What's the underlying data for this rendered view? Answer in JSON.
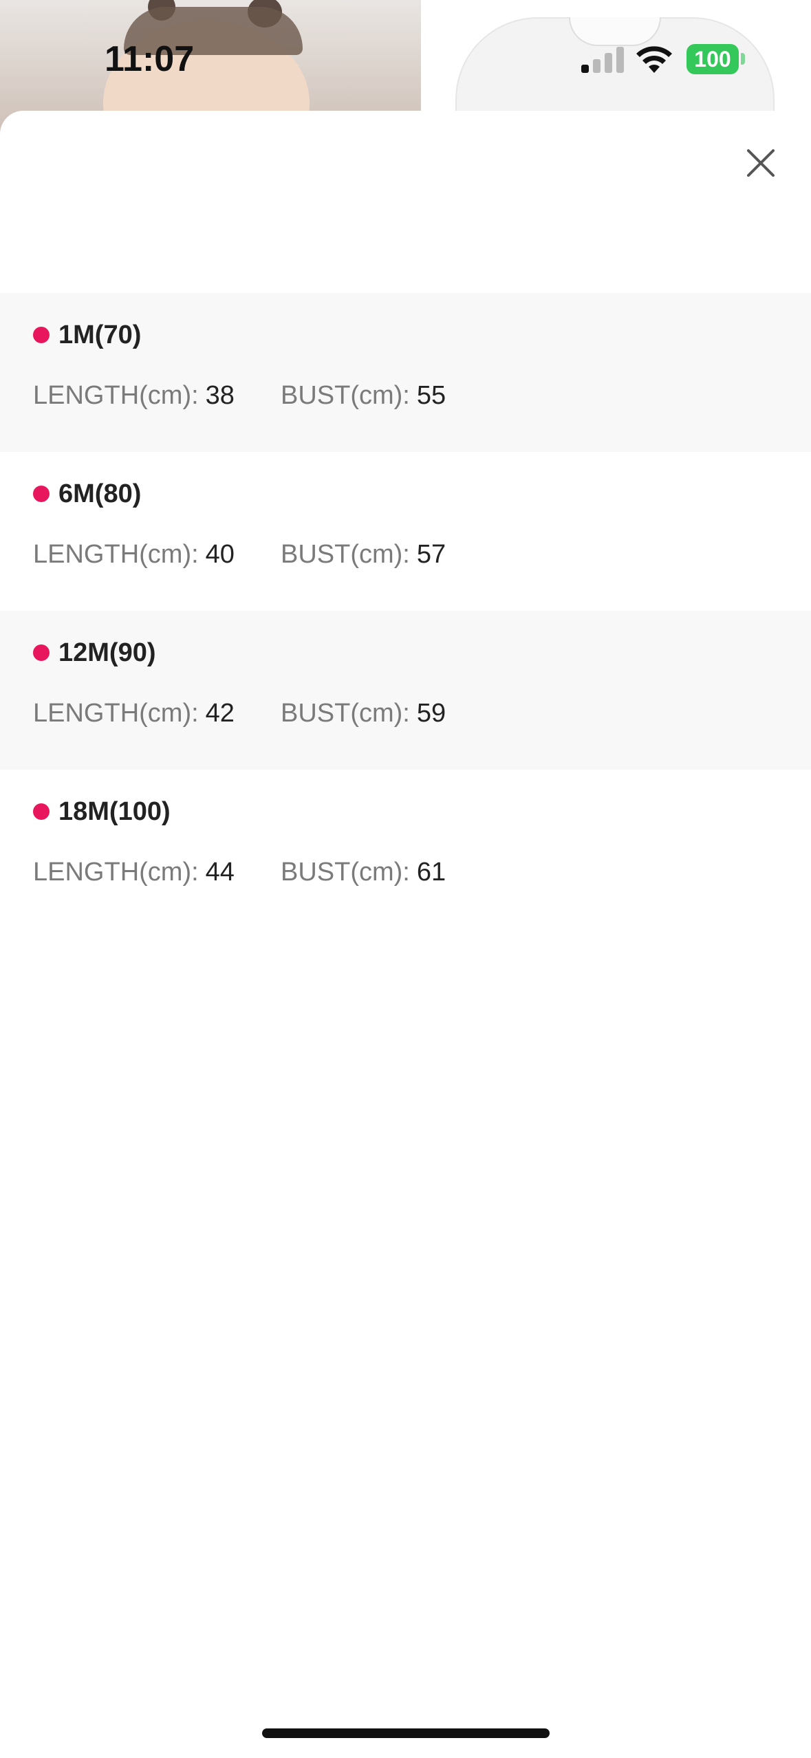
{
  "status_bar": {
    "time": "11:07",
    "battery": "100",
    "signal_icon": "cellular-signal-icon",
    "wifi_icon": "wifi-icon",
    "battery_color": "#34c759"
  },
  "sheet": {
    "close_icon": "close-icon",
    "accent_color": "#e8175d",
    "sizes": [
      {
        "name": "1M(70)",
        "length_label": "LENGTH(cm):",
        "length": "38",
        "bust_label": "BUST(cm):",
        "bust": "55"
      },
      {
        "name": "6M(80)",
        "length_label": "LENGTH(cm):",
        "length": "40",
        "bust_label": "BUST(cm):",
        "bust": "57"
      },
      {
        "name": "12M(90)",
        "length_label": "LENGTH(cm):",
        "length": "42",
        "bust_label": "BUST(cm):",
        "bust": "59"
      },
      {
        "name": "18M(100)",
        "length_label": "LENGTH(cm):",
        "length": "44",
        "bust_label": "BUST(cm):",
        "bust": "61"
      }
    ]
  }
}
